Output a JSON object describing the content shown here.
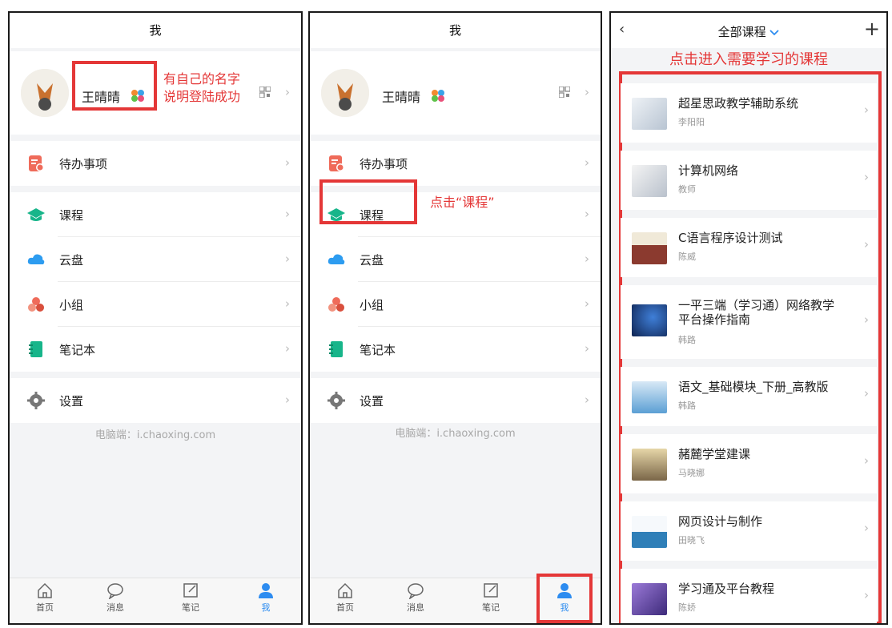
{
  "screen1": {
    "title": "我",
    "profile": {
      "name": "王晴晴"
    },
    "annotation": [
      "有自己的名字",
      "说明登陆成功"
    ],
    "menu": [
      {
        "label": "待办事项",
        "icon": "todo-icon",
        "color": "#ef6b5a"
      },
      {
        "label": "课程",
        "icon": "course-icon",
        "color": "#17b58a"
      },
      {
        "label": "云盘",
        "icon": "cloud-icon",
        "color": "#2d9cf0"
      },
      {
        "label": "小组",
        "icon": "group-icon",
        "color": "#ef6b5a"
      },
      {
        "label": "笔记本",
        "icon": "notebook-icon",
        "color": "#17b58a"
      },
      {
        "label": "设置",
        "icon": "gear-icon",
        "color": "#777777"
      }
    ],
    "pc_url": "电脑端：i.chaoxing.com",
    "tabs": [
      "首页",
      "消息",
      "笔记",
      "我"
    ]
  },
  "screen2": {
    "title": "我",
    "profile": {
      "name": "王晴晴"
    },
    "annotation": "点击“课程”",
    "menu": [
      {
        "label": "待办事项"
      },
      {
        "label": "课程"
      },
      {
        "label": "云盘"
      },
      {
        "label": "小组"
      },
      {
        "label": "笔记本"
      },
      {
        "label": "设置"
      }
    ],
    "pc_url": "电脑端：i.chaoxing.com",
    "tabs": [
      "首页",
      "消息",
      "笔记",
      "我"
    ]
  },
  "screen3": {
    "title": "全部课程",
    "back_icon": "back-chevron-icon",
    "plus": "+",
    "annotation": "点击进入需要学习的课程",
    "courses": [
      {
        "name": "超星思政教学辅助系统",
        "teacher": "李阳阳"
      },
      {
        "name": "计算机网络",
        "teacher": "教师"
      },
      {
        "name": "C语言程序设计测试",
        "teacher": "陈威"
      },
      {
        "name": "一平三端（学习通）网络教学",
        "name2": "平台操作指南",
        "teacher": "韩路"
      },
      {
        "name": "语文_基础模块_下册_高教版",
        "teacher": "韩路"
      },
      {
        "name": "赭麓学堂建课",
        "teacher": "马晓娜"
      },
      {
        "name": "网页设计与制作",
        "teacher": "田晓飞"
      },
      {
        "name": "学习通及平台教程",
        "teacher": "陈娇"
      }
    ],
    "thumb_colors": [
      "#d6dde6",
      "#ccd2dc",
      "#8b3a2f",
      "#0f2452",
      "#5b9fd4",
      "#b9a074",
      "#2f7fb8",
      "#6c46a8"
    ]
  },
  "colors": {
    "accent_red": "#e43737",
    "active_blue": "#2d8cf0"
  }
}
